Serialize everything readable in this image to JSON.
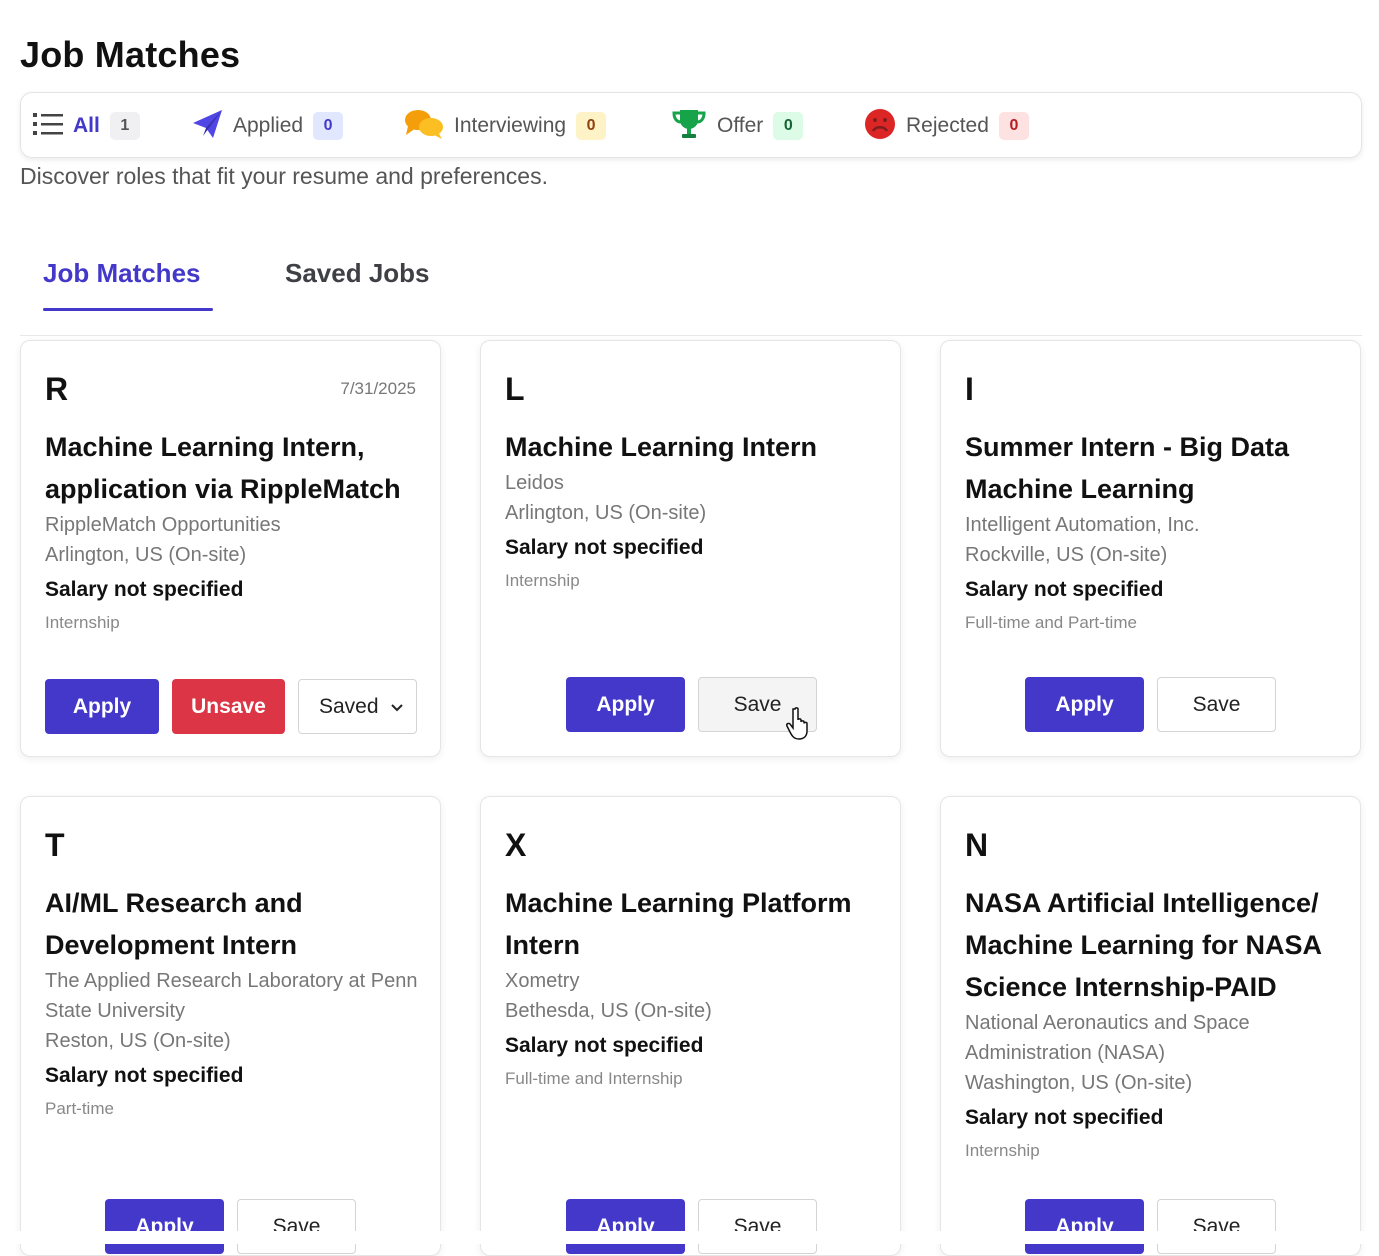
{
  "page": {
    "title": "Job Matches",
    "subtitle": "Discover roles that fit your resume and preferences."
  },
  "status_filters": [
    {
      "label": "All",
      "count": "1",
      "icon": "list-icon",
      "active": true,
      "badge_bg": "#f0f0f2",
      "badge_fg": "#555555"
    },
    {
      "label": "Applied",
      "count": "0",
      "icon": "paper-plane-icon",
      "active": false,
      "badge_bg": "#e0e7ff",
      "badge_fg": "#4338ca"
    },
    {
      "label": "Interviewing",
      "count": "0",
      "icon": "chat-bubbles-icon",
      "active": false,
      "badge_bg": "#fef3c7",
      "badge_fg": "#92400e"
    },
    {
      "label": "Offer",
      "count": "0",
      "icon": "trophy-icon",
      "active": false,
      "badge_bg": "#dcfce7",
      "badge_fg": "#166534"
    },
    {
      "label": "Rejected",
      "count": "0",
      "icon": "sad-face-icon",
      "active": false,
      "badge_bg": "#fee2e2",
      "badge_fg": "#b91c1c"
    }
  ],
  "tabs": [
    {
      "label": "Job Matches",
      "active": true
    },
    {
      "label": "Saved Jobs",
      "active": false
    }
  ],
  "buttons": {
    "apply": "Apply",
    "save": "Save",
    "unsave": "Unsave",
    "saved": "Saved"
  },
  "jobs": [
    {
      "initial": "R",
      "date": "7/31/2025",
      "title": "Machine Learning Intern, application via RippleMatch",
      "company": "RippleMatch Opportunities",
      "location": "Arlington, US (On-site)",
      "salary": "Salary not specified",
      "type": "Internship",
      "saved": true
    },
    {
      "initial": "L",
      "date": "",
      "title": "Machine Learning Intern",
      "company": "Leidos",
      "location": "Arlington, US (On-site)",
      "salary": "Salary not specified",
      "type": "Internship",
      "saved": false
    },
    {
      "initial": "I",
      "date": "",
      "title": "Summer Intern - Big Data Machine Learning",
      "company": "Intelligent Automation, Inc.",
      "location": "Rockville, US (On-site)",
      "salary": "Salary not specified",
      "type": "Full-time and Part-time",
      "saved": false
    },
    {
      "initial": "T",
      "date": "",
      "title": "AI/ML Research and Development Intern",
      "company": "The Applied Research Laboratory at Penn State University",
      "location": "Reston, US (On-site)",
      "salary": "Salary not specified",
      "type": "Part-time",
      "saved": false
    },
    {
      "initial": "X",
      "date": "",
      "title": "Machine Learning Platform Intern",
      "company": "Xometry",
      "location": "Bethesda, US (On-site)",
      "salary": "Salary not specified",
      "type": "Full-time and Internship",
      "saved": false
    },
    {
      "initial": "N",
      "date": "",
      "title": "NASA Artificial Intelligence/ Machine Learning for NASA Science Internship-PAID",
      "company": "National Aeronautics and Space Administration (NASA)",
      "location": "Washington, US (On-site)",
      "salary": "Salary not specified",
      "type": "Internship",
      "saved": false
    }
  ]
}
